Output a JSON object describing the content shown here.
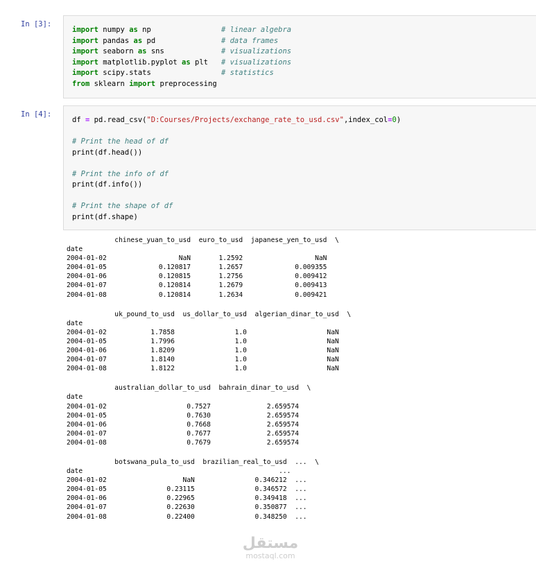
{
  "cells": [
    {
      "prompt": "In [3]:",
      "lines": [
        {
          "parts": [
            {
              "t": "import",
              "c": "kw"
            },
            {
              "t": " numpy "
            },
            {
              "t": "as",
              "c": "kw"
            },
            {
              "t": " np                "
            },
            {
              "t": "# linear algebra",
              "c": "cm"
            }
          ]
        },
        {
          "parts": [
            {
              "t": "import",
              "c": "kw"
            },
            {
              "t": " pandas "
            },
            {
              "t": "as",
              "c": "kw"
            },
            {
              "t": " pd               "
            },
            {
              "t": "# data frames",
              "c": "cm"
            }
          ]
        },
        {
          "parts": [
            {
              "t": "import",
              "c": "kw"
            },
            {
              "t": " seaborn "
            },
            {
              "t": "as",
              "c": "kw"
            },
            {
              "t": " sns             "
            },
            {
              "t": "# visualizations",
              "c": "cm"
            }
          ]
        },
        {
          "parts": [
            {
              "t": "import",
              "c": "kw"
            },
            {
              "t": " matplotlib.pyplot "
            },
            {
              "t": "as",
              "c": "kw"
            },
            {
              "t": " plt   "
            },
            {
              "t": "# visualizations",
              "c": "cm"
            }
          ]
        },
        {
          "parts": [
            {
              "t": "import",
              "c": "kw"
            },
            {
              "t": " scipy.stats                "
            },
            {
              "t": "# statistics",
              "c": "cm"
            }
          ]
        },
        {
          "parts": [
            {
              "t": "from",
              "c": "kw"
            },
            {
              "t": " sklearn "
            },
            {
              "t": "import",
              "c": "kw"
            },
            {
              "t": " preprocessing"
            }
          ]
        }
      ]
    },
    {
      "prompt": "In [4]:",
      "lines": [
        {
          "parts": [
            {
              "t": "df "
            },
            {
              "t": "=",
              "c": "op"
            },
            {
              "t": " pd.read_csv("
            },
            {
              "t": "\"D:Courses/Projects/exchange_rate_to_usd.csv\"",
              "c": "str"
            },
            {
              "t": ",index_col"
            },
            {
              "t": "=",
              "c": "op"
            },
            {
              "t": "0",
              "c": "num"
            },
            {
              "t": ")"
            }
          ]
        },
        {
          "parts": [
            {
              "t": ""
            }
          ]
        },
        {
          "parts": [
            {
              "t": "# Print the head of df",
              "c": "cm"
            }
          ]
        },
        {
          "parts": [
            {
              "t": "print(df.head())"
            }
          ]
        },
        {
          "parts": [
            {
              "t": ""
            }
          ]
        },
        {
          "parts": [
            {
              "t": "# Print the info of df",
              "c": "cm"
            }
          ]
        },
        {
          "parts": [
            {
              "t": "print(df.info())"
            }
          ]
        },
        {
          "parts": [
            {
              "t": ""
            }
          ]
        },
        {
          "parts": [
            {
              "t": "# Print the shape of df",
              "c": "cm"
            }
          ]
        },
        {
          "parts": [
            {
              "t": "print(df.shape)"
            }
          ]
        }
      ]
    }
  ],
  "output_blocks": [
    {
      "header": "            chinese_yuan_to_usd  euro_to_usd  japanese_yen_to_usd  \\",
      "index_label": "date",
      "rows": [
        "2004-01-02                  NaN       1.2592                  NaN   ",
        "2004-01-05             0.120817       1.2657             0.009355   ",
        "2004-01-06             0.120815       1.2756             0.009412   ",
        "2004-01-07             0.120814       1.2679             0.009413   ",
        "2004-01-08             0.120814       1.2634             0.009421   "
      ]
    },
    {
      "header": "            uk_pound_to_usd  us_dollar_to_usd  algerian_dinar_to_usd  \\",
      "index_label": "date",
      "rows": [
        "2004-01-02           1.7858               1.0                    NaN   ",
        "2004-01-05           1.7996               1.0                    NaN   ",
        "2004-01-06           1.8209               1.0                    NaN   ",
        "2004-01-07           1.8140               1.0                    NaN   ",
        "2004-01-08           1.8122               1.0                    NaN   "
      ]
    },
    {
      "header": "            australian_dollar_to_usd  bahrain_dinar_to_usd  \\",
      "index_label": "date",
      "rows": [
        "2004-01-02                    0.7527              2.659574   ",
        "2004-01-05                    0.7630              2.659574   ",
        "2004-01-06                    0.7668              2.659574   ",
        "2004-01-07                    0.7677              2.659574   ",
        "2004-01-08                    0.7679              2.659574   "
      ]
    },
    {
      "header": "            botswana_pula_to_usd  brazilian_real_to_usd  ...  \\",
      "index_label": "date                                                 ...     ",
      "rows": [
        "2004-01-02                   NaN               0.346212  ...   ",
        "2004-01-05               0.23115               0.346572  ...   ",
        "2004-01-06               0.22965               0.349418  ...   ",
        "2004-01-07               0.22630               0.350877  ...   ",
        "2004-01-08               0.22400               0.348250  ...   "
      ]
    }
  ],
  "watermark": {
    "arabic": "مستقل",
    "latin": "mostaql.com"
  }
}
